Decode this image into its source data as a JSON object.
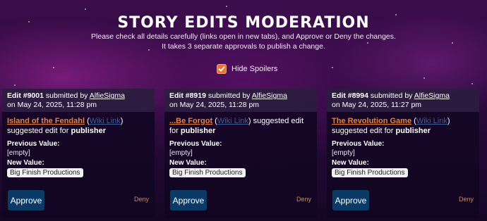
{
  "page": {
    "title": "STORY EDITS MODERATION",
    "subtitle_line1": "Please check all details carefully (links open in new tabs), and Approve or Deny the changes.",
    "subtitle_line2": "It takes 3 separate approvals to publish a change."
  },
  "spoilers": {
    "label": "Hide Spoilers",
    "checked": true
  },
  "edits": [
    {
      "id": "Edit #9001",
      "submitted_by_text": "submitted by",
      "user": "AlfieSigma",
      "date": "on May 24, 2025, 11:28 pm",
      "story": "Island of the Fendahl",
      "wiki_link": "Wiki Link",
      "suggested_text": "suggested edit for",
      "field": "publisher",
      "previous_label": "Previous Value:",
      "previous_value": "[empty]",
      "new_label": "New Value:",
      "new_value": "Big Finish Productions",
      "approve_label": "Approve",
      "deny_label": "Deny"
    },
    {
      "id": "Edit #8919",
      "submitted_by_text": "submitted by",
      "user": "AlfieSigma",
      "date": "on May 24, 2025, 11:28 pm",
      "story": "...Be Forgot",
      "wiki_link": "Wiki Link",
      "suggested_text": "suggested edit for",
      "field": "publisher",
      "previous_label": "Previous Value:",
      "previous_value": "[empty]",
      "new_label": "New Value:",
      "new_value": "Big Finish Productions",
      "approve_label": "Approve",
      "deny_label": "Deny"
    },
    {
      "id": "Edit #8994",
      "submitted_by_text": "submitted by",
      "user": "AlfieSigma",
      "date": "on May 24, 2025, 11:27 pm",
      "story": "The Revolution Game",
      "wiki_link": "Wiki Link",
      "suggested_text": "suggested edit for",
      "field": "publisher",
      "previous_label": "Previous Value:",
      "previous_value": "[empty]",
      "new_label": "New Value:",
      "new_value": "Big Finish Productions",
      "approve_label": "Approve",
      "deny_label": "Deny"
    }
  ],
  "colors": {
    "accent_orange": "#e8823a",
    "approve_blue": "#0b3a66",
    "wiki_link_blue": "#3d5d96"
  }
}
